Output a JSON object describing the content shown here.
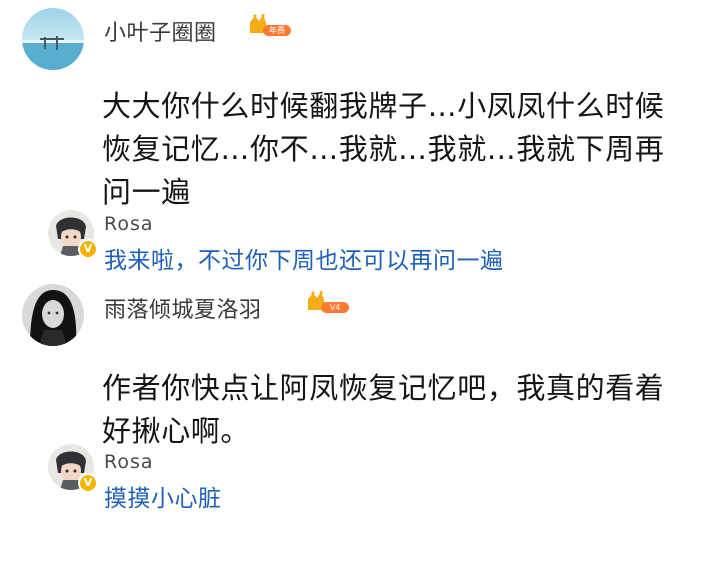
{
  "comments": [
    {
      "username": "小叶子圈圈",
      "badge_text": "年费",
      "text": "大大你什么时候翻我牌子…小凤凤什么时候恢复记忆…你不…我就…我就…我就下周再问一遍",
      "reply": {
        "author": "Rosa",
        "text": "我来啦，不过你下周也还可以再问一遍"
      }
    },
    {
      "username": "雨落倾城夏洛羽",
      "badge_text": "V4",
      "text": "作者你快点让阿凤恢复记忆吧，我真的看着好揪心啊。",
      "reply": {
        "author": "Rosa",
        "text": "摸摸小心脏"
      }
    }
  ],
  "colors": {
    "reply_link": "#1f5fb8",
    "badge_gold": "#f5b400",
    "badge_orange": "#ff7a2f"
  },
  "icons": {
    "verified": "V",
    "crown": "crown-icon"
  }
}
